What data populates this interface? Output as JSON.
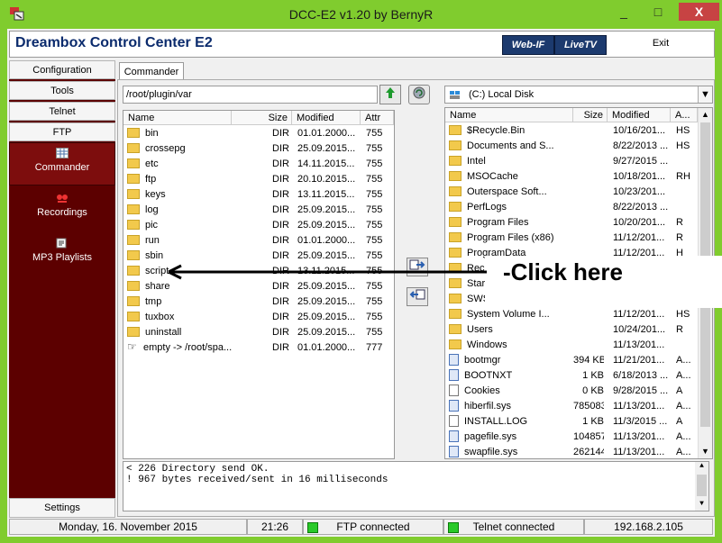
{
  "window": {
    "title": "DCC-E2 v1.20 by BernyR",
    "minimize": "_",
    "maximize": "□",
    "close": "X"
  },
  "banner": {
    "app_name": "Dreambox Control Center E2",
    "webif": "Web-IF",
    "livetv": "LiveTV",
    "exit": "Exit"
  },
  "nav": {
    "configuration": "Configuration",
    "tools": "Tools",
    "telnet": "Telnet",
    "ftp": "FTP",
    "commander": "Commander",
    "recordings": "Recordings",
    "mp3": "MP3 Playlists",
    "settings": "Settings"
  },
  "tab": {
    "label": "Commander"
  },
  "left_panel": {
    "path": "/root/plugin/var",
    "headers": [
      "Name",
      "Size",
      "Modified",
      "Attr"
    ],
    "rows": [
      {
        "name": "bin",
        "size": "DIR",
        "modified": "01.01.2000...",
        "attr": "755"
      },
      {
        "name": "crossepg",
        "size": "DIR",
        "modified": "25.09.2015...",
        "attr": "755"
      },
      {
        "name": "etc",
        "size": "DIR",
        "modified": "14.11.2015...",
        "attr": "755"
      },
      {
        "name": "ftp",
        "size": "DIR",
        "modified": "20.10.2015...",
        "attr": "755"
      },
      {
        "name": "keys",
        "size": "DIR",
        "modified": "13.11.2015...",
        "attr": "755"
      },
      {
        "name": "log",
        "size": "DIR",
        "modified": "25.09.2015...",
        "attr": "755"
      },
      {
        "name": "pic",
        "size": "DIR",
        "modified": "25.09.2015...",
        "attr": "755"
      },
      {
        "name": "run",
        "size": "DIR",
        "modified": "01.01.2000...",
        "attr": "755"
      },
      {
        "name": "sbin",
        "size": "DIR",
        "modified": "25.09.2015...",
        "attr": "755"
      },
      {
        "name": "script",
        "size": "DIR",
        "modified": "13.11.2015...",
        "attr": "755"
      },
      {
        "name": "share",
        "size": "DIR",
        "modified": "25.09.2015...",
        "attr": "755"
      },
      {
        "name": "tmp",
        "size": "DIR",
        "modified": "25.09.2015...",
        "attr": "755"
      },
      {
        "name": "tuxbox",
        "size": "DIR",
        "modified": "25.09.2015...",
        "attr": "755"
      },
      {
        "name": "uninstall",
        "size": "DIR",
        "modified": "25.09.2015...",
        "attr": "755"
      },
      {
        "name": "empty -> /root/spa...",
        "size": "DIR",
        "modified": "01.01.2000...",
        "attr": "777",
        "link": true
      }
    ]
  },
  "right_panel": {
    "drive": "(C:)  Local Disk",
    "headers": [
      "Name",
      "Size",
      "Modified",
      "A..."
    ],
    "rows": [
      {
        "name": "$Recycle.Bin",
        "size": "",
        "modified": "10/16/201...",
        "attr": "HS",
        "kind": "folder"
      },
      {
        "name": "Documents and S...",
        "size": "",
        "modified": "8/22/2013 ...",
        "attr": "HS",
        "kind": "folder"
      },
      {
        "name": "Intel",
        "size": "",
        "modified": "9/27/2015 ...",
        "attr": "",
        "kind": "folder"
      },
      {
        "name": "MSOCache",
        "size": "",
        "modified": "10/18/201...",
        "attr": "RH",
        "kind": "folder"
      },
      {
        "name": "Outerspace Soft...",
        "size": "",
        "modified": "10/23/201...",
        "attr": "",
        "kind": "folder"
      },
      {
        "name": "PerfLogs",
        "size": "",
        "modified": "8/22/2013 ...",
        "attr": "",
        "kind": "folder"
      },
      {
        "name": "Program Files",
        "size": "",
        "modified": "10/20/201...",
        "attr": "R",
        "kind": "folder"
      },
      {
        "name": "Program Files (x86)",
        "size": "",
        "modified": "11/12/201...",
        "attr": "R",
        "kind": "folder"
      },
      {
        "name": "ProgramData",
        "size": "",
        "modified": "11/12/201...",
        "attr": "H",
        "kind": "folder"
      },
      {
        "name": "Recover",
        "size": "",
        "modified": "",
        "attr": "",
        "kind": "folder"
      },
      {
        "name": "Starsat",
        "size": "",
        "modified": "",
        "attr": "",
        "kind": "folder"
      },
      {
        "name": "SWSetu",
        "size": "",
        "modified": "",
        "attr": "",
        "kind": "folder"
      },
      {
        "name": "System Volume I...",
        "size": "",
        "modified": "11/12/201...",
        "attr": "HS",
        "kind": "folder"
      },
      {
        "name": "Users",
        "size": "",
        "modified": "10/24/201...",
        "attr": "R",
        "kind": "folder"
      },
      {
        "name": "Windows",
        "size": "",
        "modified": "11/13/201...",
        "attr": "",
        "kind": "folder"
      },
      {
        "name": "bootmgr",
        "size": "394 KB",
        "modified": "11/21/201...",
        "attr": "A...",
        "kind": "sys"
      },
      {
        "name": "BOOTNXT",
        "size": "1 KB",
        "modified": "6/18/2013 ...",
        "attr": "A...",
        "kind": "sys"
      },
      {
        "name": "Cookies",
        "size": "0 KB",
        "modified": "9/28/2015 ...",
        "attr": "A",
        "kind": "file"
      },
      {
        "name": "hiberfil.sys",
        "size": "785083 ...",
        "modified": "11/13/201...",
        "attr": "A...",
        "kind": "sys"
      },
      {
        "name": "INSTALL.LOG",
        "size": "1 KB",
        "modified": "11/3/2015 ...",
        "attr": "A",
        "kind": "file"
      },
      {
        "name": "pagefile.sys",
        "size": "1048576...",
        "modified": "11/13/201...",
        "attr": "A...",
        "kind": "sys"
      },
      {
        "name": "swapfile.sys",
        "size": "262144 ...",
        "modified": "11/13/201...",
        "attr": "A...",
        "kind": "sys"
      }
    ]
  },
  "log": {
    "lines": [
      "< 226 Directory send OK.",
      "! 967 bytes received/sent in 16 milliseconds"
    ]
  },
  "status": {
    "date": "Monday, 16. November 2015",
    "time": "21:26",
    "ftp": "FTP connected",
    "telnet": "Telnet connected",
    "ip": "192.168.2.105"
  },
  "annotation": {
    "text": "-Click here"
  },
  "colors": {
    "window_frame": "#80cc2e",
    "nav_dark": "#5c0000",
    "nav_selected": "#7d0d0d",
    "led_on": "#29c929"
  }
}
